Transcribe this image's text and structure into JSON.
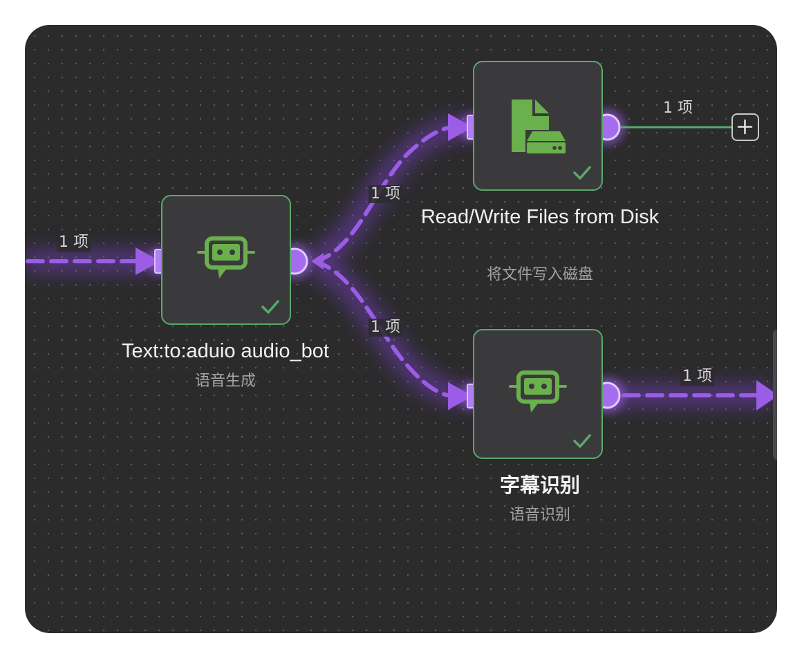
{
  "colors": {
    "canvas": "#2b2b2c",
    "node_border_success": "#5aaa6a",
    "connection": "#9b5de5",
    "icon_green": "#6ab04c",
    "plain_connection": "#5aaa6a"
  },
  "nodes": [
    {
      "id": "tts",
      "title": "Text:to:aduio audio_bot",
      "subtitle": "语音生成",
      "icon": "robot-chat-icon",
      "status": "success"
    },
    {
      "id": "rw",
      "title": "Read/Write Files from Disk",
      "subtitle": "将文件写入磁盘",
      "icon": "file-disk-icon",
      "status": "success"
    },
    {
      "id": "asr",
      "title": "字幕识别",
      "subtitle": "语音识别",
      "icon": "robot-chat-icon",
      "status": "success"
    }
  ],
  "edges": [
    {
      "id": "incoming",
      "label": "1 项"
    },
    {
      "id": "tts_to_rw",
      "label": "1 项"
    },
    {
      "id": "tts_to_asr",
      "label": "1 项"
    },
    {
      "id": "rw_to_add",
      "label": "1 项"
    },
    {
      "id": "asr_to_next",
      "label": "1 项"
    }
  ]
}
